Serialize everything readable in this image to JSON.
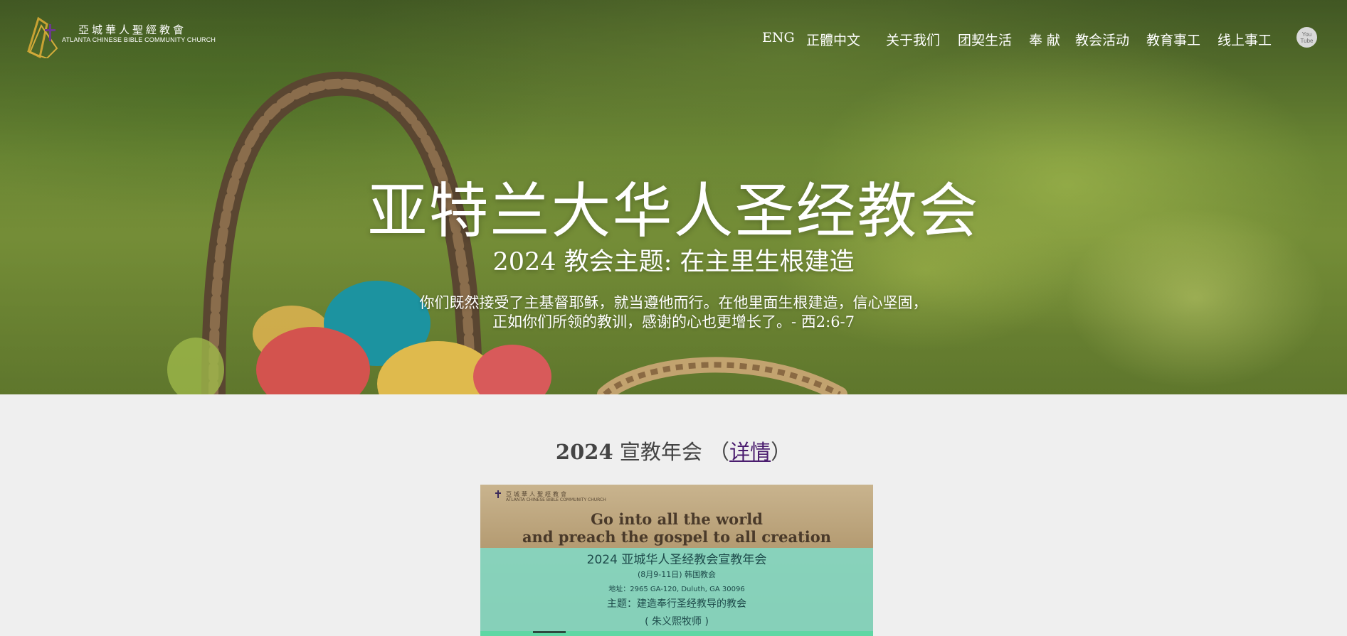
{
  "header": {
    "logo_cn": "亞城華人聖經教會",
    "logo_en": "ATLANTA CHINESE BIBLE COMMUNITY CHURCH",
    "nav": [
      "ENG",
      "正體中文",
      "关于我们",
      "团契生活",
      "奉 献",
      "教会活动",
      "教育事工",
      "线上事工"
    ],
    "youtube_top": "You",
    "youtube_bottom": "Tube"
  },
  "hero": {
    "title": "亚特兰大华人圣经教会",
    "subtitle": "2024 教会主题: 在主里生根建造",
    "verse_line1": "你们既然接受了主基督耶稣，就当遵他而行。在他里面生根建造，信心坚固，",
    "verse_line2": "正如你们所领的教训，感谢的心也更增长了。- 西2:6-7"
  },
  "section": {
    "heading_year": "2024",
    "heading_text": " 宣教年会 （",
    "heading_link": "详情",
    "heading_close": "）"
  },
  "poster": {
    "logo_cn": "亞城華人聖經教會",
    "logo_en": "ATLANTA CHINESE BIBLE COMMUNITY CHURCH",
    "line1": "Go into all the world",
    "line2": "and preach the gospel to all creation",
    "title": "2024 亚城华人圣经教会宣教年会",
    "date": "(8月9-11日) 韩国教会",
    "address": "地址：2965 GA-120, Duluth, GA 30096",
    "theme": "主题：建造奉行圣经教导的教会",
    "speaker": "( 朱义熙牧师 )"
  },
  "colors": {
    "link": "#4b1d6f",
    "page_bg": "#efefef",
    "heading": "#444444"
  }
}
